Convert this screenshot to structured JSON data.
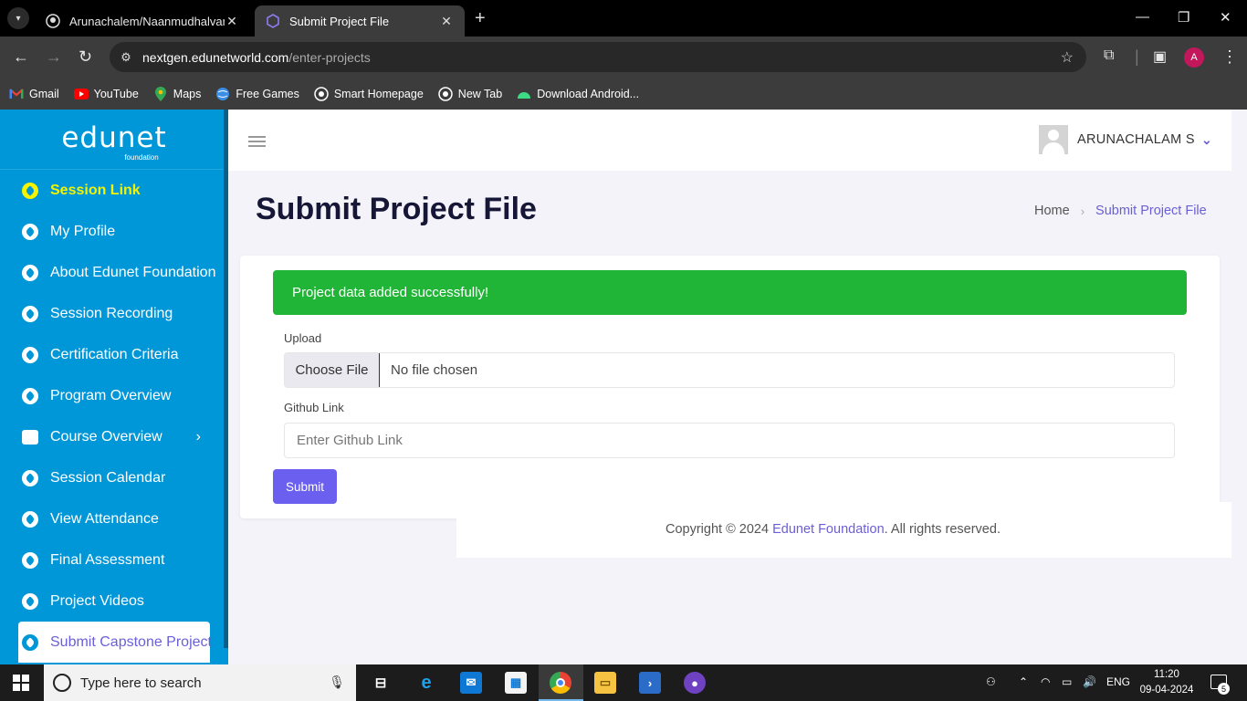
{
  "browser": {
    "tabs": [
      {
        "title": "Arunachalem/Naanmudhalvan_",
        "icon": "github-icon"
      },
      {
        "title": "Submit Project File",
        "icon": "edunet-icon"
      }
    ],
    "url_host": "nextgen.edunetworld.com",
    "url_path": "/enter-projects",
    "profile_initial": "A",
    "bookmarks": [
      {
        "label": "Gmail",
        "icon": "gmail-icon"
      },
      {
        "label": "YouTube",
        "icon": "youtube-icon"
      },
      {
        "label": "Maps",
        "icon": "maps-icon"
      },
      {
        "label": "Free Games",
        "icon": "globe-icon"
      },
      {
        "label": "Smart Homepage",
        "icon": "globe-icon"
      },
      {
        "label": "New Tab",
        "icon": "globe-icon"
      },
      {
        "label": "Download Android...",
        "icon": "android-icon"
      }
    ]
  },
  "sidebar": {
    "logo_text": "edunet",
    "logo_sub": "foundation",
    "items": [
      {
        "label": "Session Link"
      },
      {
        "label": "My Profile"
      },
      {
        "label": "About Edunet Foundation"
      },
      {
        "label": "Session Recording"
      },
      {
        "label": "Certification Criteria"
      },
      {
        "label": "Program Overview"
      },
      {
        "label": "Course Overview",
        "chevron": "›"
      },
      {
        "label": "Session Calendar"
      },
      {
        "label": "View Attendance"
      },
      {
        "label": "Final Assessment"
      },
      {
        "label": "Project Videos"
      },
      {
        "label": "Submit Capstone Project"
      }
    ]
  },
  "header": {
    "user_name": "ARUNACHALAM S"
  },
  "page": {
    "title": "Submit Project File",
    "breadcrumb_home": "Home",
    "breadcrumb_current": "Submit Project File"
  },
  "form": {
    "alert": "Project data added successfully!",
    "upload_label": "Upload",
    "choose_file": "Choose File",
    "no_file": "No file chosen",
    "github_label": "Github Link",
    "github_placeholder": "Enter Github Link",
    "submit": "Submit"
  },
  "footer": {
    "prefix": "Copyright © 2024 ",
    "link": "Edunet Foundation",
    "suffix": ". All rights reserved."
  },
  "taskbar": {
    "search_placeholder": "Type here to search",
    "language": "ENG",
    "time": "11:20",
    "date": "09-04-2024",
    "notification_count": "5"
  },
  "colors": {
    "sidebar_bg": "#0097d9",
    "accent": "#6a5fef",
    "success": "#21b538",
    "highlight": "#f4f300"
  }
}
